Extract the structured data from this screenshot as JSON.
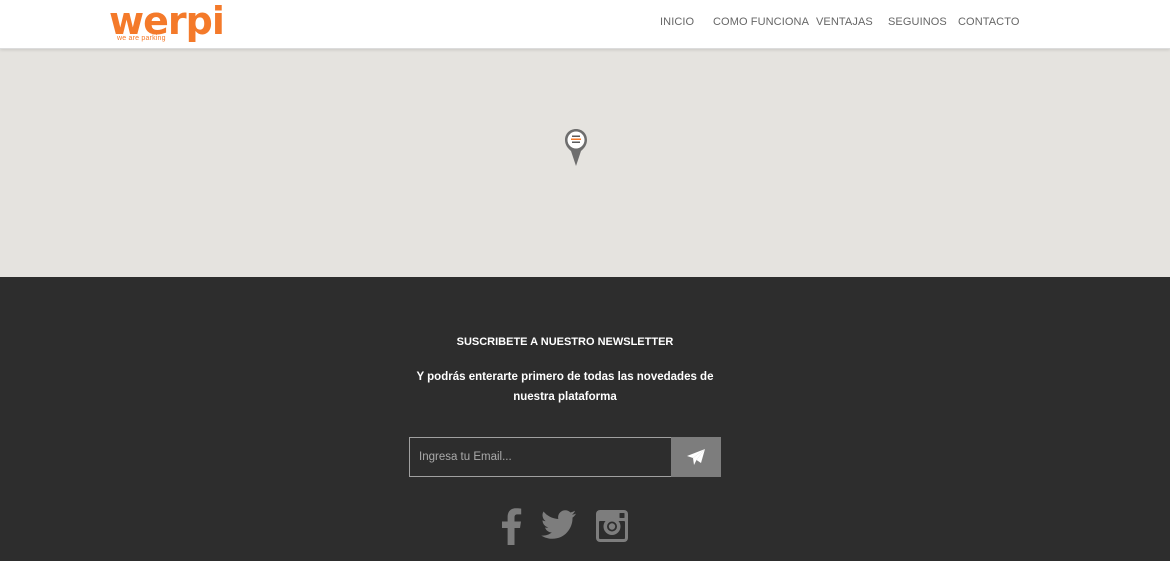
{
  "brand": {
    "name": "werpi",
    "tagline": "we are parking",
    "color": "#f47a2a"
  },
  "nav": {
    "items": [
      {
        "label": "INICIO"
      },
      {
        "label": "COMO FUNCIONA"
      },
      {
        "label": "VENTAJAS"
      },
      {
        "label": "SEGUINOS"
      },
      {
        "label": "CONTACTO"
      }
    ]
  },
  "map": {
    "background": "#e5e3df",
    "marker_icon": "map-pin-icon"
  },
  "newsletter": {
    "title": "SUSCRIBETE A NUESTRO NEWSLETTER",
    "description_line1": "Y podrás enterarte primero de todas las novedades de",
    "description_line2": "nuestra plataforma",
    "email_placeholder": "Ingresa tu Email...",
    "email_value": "",
    "submit_icon": "paper-plane-icon"
  },
  "social": {
    "items": [
      {
        "icon": "facebook-icon"
      },
      {
        "icon": "twitter-icon"
      },
      {
        "icon": "instagram-icon"
      }
    ],
    "icon_color": "#7d7d7d"
  },
  "colors": {
    "footer_bg": "#2d2d2d",
    "nav_text": "#666666",
    "button_bg": "#7d7d7d"
  }
}
